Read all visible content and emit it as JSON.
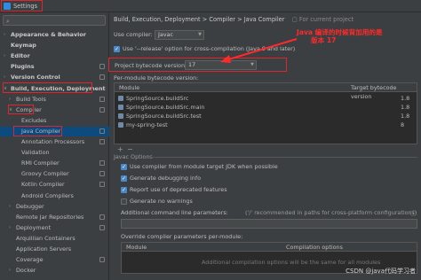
{
  "window": {
    "title": "Settings"
  },
  "sidebar": {
    "search_placeholder": "",
    "items": [
      {
        "label": "Appearance & Behavior",
        "level": 0,
        "expanded": false,
        "bold": true
      },
      {
        "label": "Keymap",
        "level": 0,
        "bold": true
      },
      {
        "label": "Editor",
        "level": 0,
        "expanded": false,
        "bold": true
      },
      {
        "label": "Plugins",
        "level": 0,
        "bold": true
      },
      {
        "label": "Version Control",
        "level": 0,
        "expanded": false,
        "bold": true
      },
      {
        "label": "Build, Execution, Deployment",
        "level": 0,
        "expanded": true,
        "bold": true
      },
      {
        "label": "Build Tools",
        "level": 1,
        "expanded": false
      },
      {
        "label": "Compiler",
        "level": 1,
        "expanded": true
      },
      {
        "label": "Excludes",
        "level": 2
      },
      {
        "label": "Java Compiler",
        "level": 2,
        "selected": true
      },
      {
        "label": "Annotation Processors",
        "level": 2
      },
      {
        "label": "Validation",
        "level": 2
      },
      {
        "label": "RMI Compiler",
        "level": 2
      },
      {
        "label": "Groovy Compiler",
        "level": 2
      },
      {
        "label": "Kotlin Compiler",
        "level": 2
      },
      {
        "label": "Android Compilers",
        "level": 2
      },
      {
        "label": "Debugger",
        "level": 1,
        "expanded": false
      },
      {
        "label": "Remote Jar Repositories",
        "level": 1
      },
      {
        "label": "Deployment",
        "level": 1,
        "expanded": false
      },
      {
        "label": "Arquillian Containers",
        "level": 1
      },
      {
        "label": "Application Servers",
        "level": 1
      },
      {
        "label": "Coverage",
        "level": 1
      },
      {
        "label": "Docker",
        "level": 1,
        "expanded": false
      }
    ]
  },
  "breadcrumb": {
    "parts": [
      "Build, Execution, Deployment",
      "Compiler",
      "Java Compiler"
    ],
    "separator": ">",
    "text": "Build, Execution, Deployment  >  Compiler  >  Java Compiler",
    "for_project": "For current project"
  },
  "form": {
    "use_compiler_label": "Use compiler:",
    "use_compiler_value": "Javac",
    "release_option_label": "Use '--release' option for cross-compilation (Java 9 and later)",
    "release_option_checked": true,
    "project_bytecode_label": "Project bytecode version:",
    "project_bytecode_value": "17",
    "per_module_label": "Per-module bytecode version:"
  },
  "module_table": {
    "headers": [
      "Module",
      "Target bytecode version"
    ],
    "rows": [
      {
        "module": "SpringSource.buildSrc",
        "version": "1.8"
      },
      {
        "module": "SpringSource.buildSrc.main",
        "version": "1.8"
      },
      {
        "module": "SpringSource.buildSrc.test",
        "version": "1.8"
      },
      {
        "module": "my-spring-test",
        "version": "8"
      }
    ],
    "add_btn": "+",
    "remove_btn": "−"
  },
  "javac_options": {
    "section_title": "Javac Options",
    "options": [
      {
        "label": "Use compiler from module target JDK when possible",
        "checked": true
      },
      {
        "label": "Generate debugging info",
        "checked": true
      },
      {
        "label": "Report use of deprecated features",
        "checked": true
      },
      {
        "label": "Generate no warnings",
        "checked": false
      }
    ],
    "additional_params_label": "Additional command line parameters:",
    "additional_params_hint": "('/' recommended in paths for cross-platform configurations)",
    "override_label": "Override compiler parameters per-module:",
    "override_headers": [
      "Module",
      "Compilation options"
    ],
    "override_hint": "Additional compilation options will be the same for all modules"
  },
  "annotation": {
    "line1": "Java 编译的时候背加用的是",
    "line2": "版本 17",
    "color": "#ff2a2a"
  },
  "watermark": "CSDN @java代码学习者",
  "colors": {
    "background": "#3c3f41",
    "selection": "#0d4a7e",
    "highlight_box": "#e0262b",
    "checkbox_on": "#4a88c7"
  }
}
